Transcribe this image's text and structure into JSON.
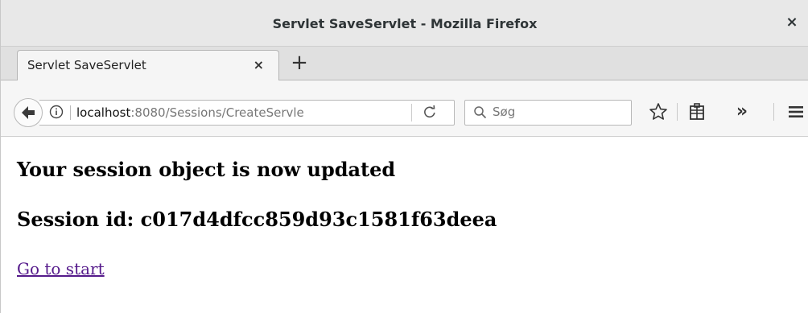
{
  "window": {
    "title": "Servlet SaveServlet - Mozilla Firefox",
    "close_glyph": "×"
  },
  "tabs": [
    {
      "label": "Servlet SaveServlet",
      "close_glyph": "×"
    }
  ],
  "newtab_glyph": "+",
  "nav": {
    "url_host": "localhost",
    "url_rest": ":8080/Sessions/CreateServle",
    "search_placeholder": "Søg",
    "overflow_glyph": "»",
    "icons": [
      "back-arrow-icon",
      "info-icon",
      "reload-icon",
      "search-icon",
      "bookmark-star-icon",
      "reading-list-icon",
      "overflow-chevrons-icon",
      "hamburger-menu-icon"
    ]
  },
  "page": {
    "heading": "Your session object is now updated",
    "session_line": "Session id: c017d4dfcc859d93c1581f63deea",
    "link_text": "Go to start"
  },
  "colors": {
    "titlebar_bg": "#e8e8e8",
    "link_visited": "#551a8b",
    "accent": "#2e3436"
  }
}
